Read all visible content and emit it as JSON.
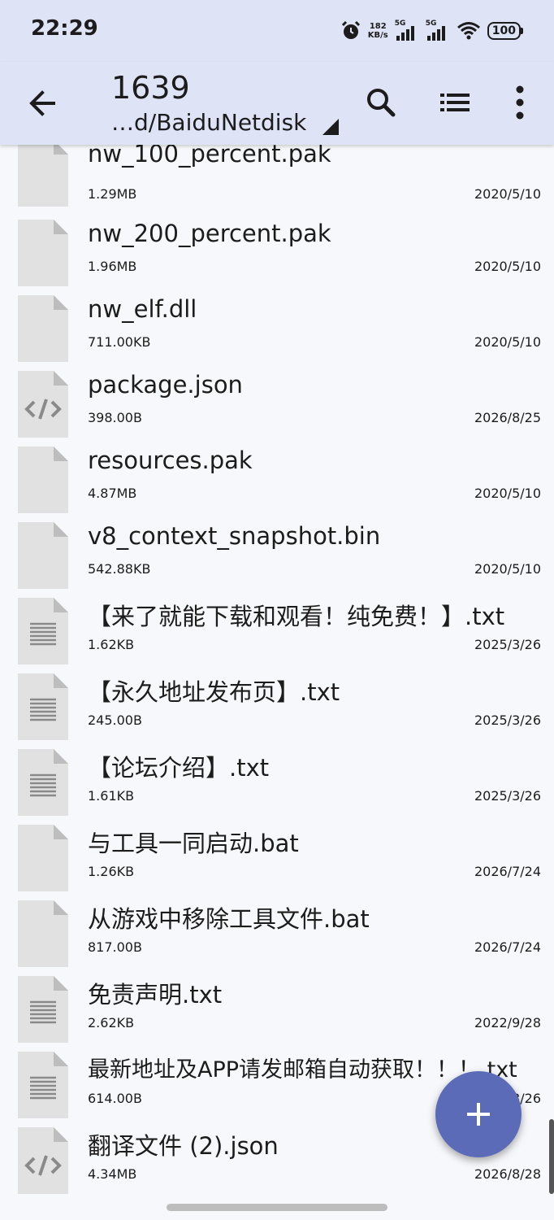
{
  "status_bar": {
    "time": "22:29",
    "net_speed_value": "182",
    "net_speed_unit": "KB/s",
    "signal1_label": "5G",
    "signal2_label": "5G",
    "battery": "100"
  },
  "app_bar": {
    "title": "1639",
    "path": "…d/BaiduNetdisk"
  },
  "files": [
    {
      "name": "nw_100_percent.pak",
      "size": "1.29MB",
      "date": "2020/5/10",
      "icon": "file-icon"
    },
    {
      "name": "nw_200_percent.pak",
      "size": "1.96MB",
      "date": "2020/5/10",
      "icon": "file-icon"
    },
    {
      "name": "nw_elf.dll",
      "size": "711.00KB",
      "date": "2020/5/10",
      "icon": "file-icon"
    },
    {
      "name": "package.json",
      "size": "398.00B",
      "date": "2026/8/25",
      "icon": "code-file-icon"
    },
    {
      "name": "resources.pak",
      "size": "4.87MB",
      "date": "2020/5/10",
      "icon": "file-icon"
    },
    {
      "name": "v8_context_snapshot.bin",
      "size": "542.88KB",
      "date": "2020/5/10",
      "icon": "file-icon"
    },
    {
      "name": "【来了就能下载和观看！纯免费！】.txt",
      "size": "1.62KB",
      "date": "2025/3/26",
      "icon": "text-file-icon"
    },
    {
      "name": "【永久地址发布页】.txt",
      "size": "245.00B",
      "date": "2025/3/26",
      "icon": "text-file-icon"
    },
    {
      "name": "【论坛介绍】.txt",
      "size": "1.61KB",
      "date": "2025/3/26",
      "icon": "text-file-icon"
    },
    {
      "name": "与工具一同启动.bat",
      "size": "1.26KB",
      "date": "2026/7/24",
      "icon": "file-icon"
    },
    {
      "name": "从游戏中移除工具文件.bat",
      "size": "817.00B",
      "date": "2026/7/24",
      "icon": "file-icon"
    },
    {
      "name": "免责声明.txt",
      "size": "2.62KB",
      "date": "2022/9/28",
      "icon": "text-file-icon"
    },
    {
      "name": "最新地址及APP请发邮箱自动获取！！！.txt",
      "size": "614.00B",
      "date": "2025/3/26",
      "icon": "text-file-icon"
    },
    {
      "name": "翻译文件 (2).json",
      "size": "4.34MB",
      "date": "2026/8/28",
      "icon": "code-file-icon"
    }
  ]
}
